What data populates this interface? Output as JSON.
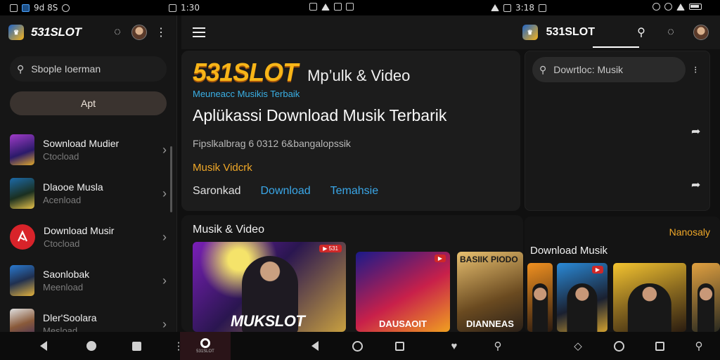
{
  "status_bar": {
    "left_time": "9d 8S",
    "mid_time": "1:30",
    "right_time": "3:18"
  },
  "sidebar": {
    "brand": "531SLOT",
    "search_placeholder": "Sbople Ioerman",
    "primary_button": "Apt",
    "items": [
      {
        "title": "Sownload Mudier",
        "subtitle": "Ctocload"
      },
      {
        "title": "Dlaooe Musla",
        "subtitle": "Acenload"
      },
      {
        "title": "Download Musir",
        "subtitle": "Ctocload"
      },
      {
        "title": "Saonlobak",
        "subtitle": "Meenload"
      },
      {
        "title": "Dler'Soolara",
        "subtitle": "Mesload"
      }
    ]
  },
  "topbar": {
    "brand": "531SLOT"
  },
  "hero": {
    "logo": "531SLOT",
    "logo_sub": "Mp’ulk & Video",
    "tagline": "Meuneacc Musikis Terbaik",
    "title": "Aplükassi Download Musik Terbarik",
    "description": "Fipslkalbrag 6 0312 6&bangalopssik",
    "category": "Musik Vidcrk",
    "actions": {
      "plain": "Saronkad",
      "download": "Download",
      "terbaru": "Temahsie"
    }
  },
  "right_panel": {
    "search_placeholder": "Dowrtloc: Musik"
  },
  "section_main": {
    "title": "Musik & Video",
    "cards": [
      {
        "label": "MUKSLOT",
        "badge": "▶ 531"
      },
      {
        "label": "DAUSAOIT",
        "badge": "▶"
      },
      {
        "label": "DIANNEAS",
        "toplabel": "BASIIK PIODO"
      }
    ]
  },
  "section_right": {
    "link": "Nanosaly",
    "title": "Download Musik",
    "badge": "▶"
  },
  "navbar": {
    "active_caption": "531SLOT"
  },
  "colors": {
    "accent_orange": "#f0a828",
    "accent_blue": "#3aa7e8",
    "logo_gold": "#f7b518"
  }
}
